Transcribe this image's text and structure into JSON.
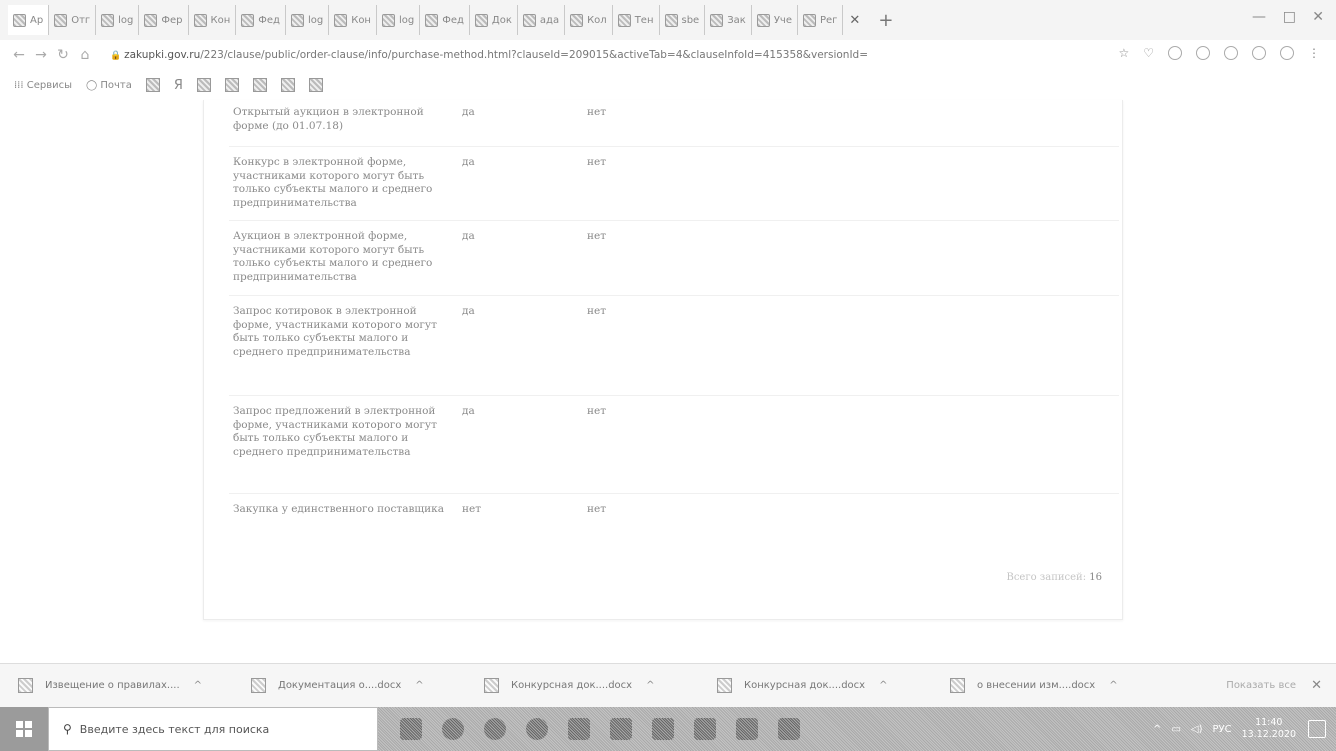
{
  "browser": {
    "tabs": [
      "Ap",
      "Отг",
      "log",
      "Фер",
      "Кон",
      "Фед",
      "log",
      "Кон",
      "log",
      "Фед",
      "Док",
      "ада",
      "Кол",
      "Тен",
      "sbe",
      "Зак",
      "Уче",
      "Рег"
    ],
    "url_domain": "zakupki.gov.ru",
    "url_path": "/223/clause/public/order-clause/info/purchase-method.html?clauseId=209015&activeTab=4&clauseInfoId=415358&versionId=",
    "window_controls": {
      "minimize": "—",
      "maximize": "□",
      "close": "✕"
    }
  },
  "bookmarks": {
    "apps_label": "Сервисы",
    "mail_label": "Почта"
  },
  "table": {
    "rows": [
      {
        "name": "Открытый аукцион в электронной форме (до 01.07.18)",
        "col2": "да",
        "col3": "нет"
      },
      {
        "name": "Конкурс в электронной форме, участниками которого могут быть только субъекты малого и среднего предпринимательства",
        "col2": "да",
        "col3": "нет"
      },
      {
        "name": "Аукцион в электронной форме, участниками которого могут быть только субъекты малого и среднего предпринимательства",
        "col2": "да",
        "col3": "нет"
      },
      {
        "name": "Запрос котировок в электронной форме, участниками которого могут быть только субъекты малого и среднего предпринимательства",
        "col2": "да",
        "col3": "нет"
      },
      {
        "name": "Запрос предложений в электронной форме, участниками которого могут быть только субъекты малого и среднего предпринимательства",
        "col2": "да",
        "col3": "нет"
      },
      {
        "name": "Закупка у единственного поставщика",
        "col2": "нет",
        "col3": "нет"
      }
    ],
    "total_label": "Всего записей:",
    "total_count": "16"
  },
  "downloads": {
    "items": [
      "Извещение о правилах....",
      "Документация о....docx",
      "Конкурсная док....docx",
      "Конкурсная док....docx",
      "о внесении изм....docx"
    ],
    "show_all": "Показать все"
  },
  "taskbar": {
    "search_placeholder": "Введите здесь текст для поиска",
    "lang": "РУС",
    "time": "11:40",
    "date": "13.12.2020"
  }
}
